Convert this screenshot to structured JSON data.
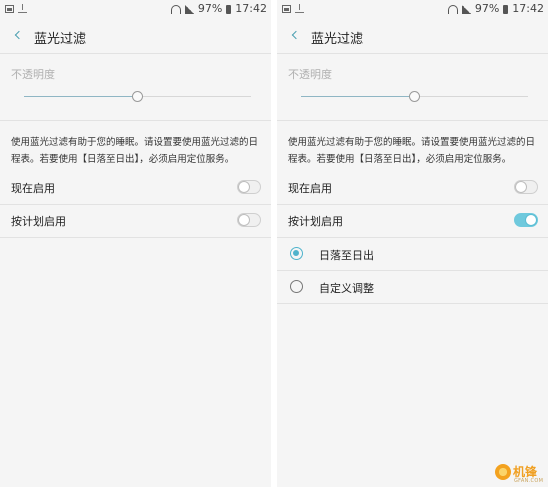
{
  "status_bar": {
    "battery": "97%",
    "time": "17:42"
  },
  "screen": {
    "title": "蓝光过滤",
    "opacity_label": "不透明度",
    "opacity_level": 0.5,
    "description": "使用蓝光过滤有助于您的睡眠。请设置要使用蓝光过滤的日程表。若要使用【日落至日出】，必须启用定位服务。",
    "enable_now_label": "现在启用",
    "schedule_label": "按计划启用"
  },
  "left": {
    "enable_now": false,
    "schedule": false
  },
  "right": {
    "enable_now": false,
    "schedule": true,
    "options": [
      {
        "label": "日落至日出",
        "selected": true
      },
      {
        "label": "自定义调整",
        "selected": false
      }
    ]
  },
  "watermark": {
    "text": "机锋",
    "sub": "GFAN.COM"
  },
  "colors": {
    "accent": "#4fb3cc",
    "toggle_on": "#6fc9dd",
    "background": "#f5f5f5"
  }
}
